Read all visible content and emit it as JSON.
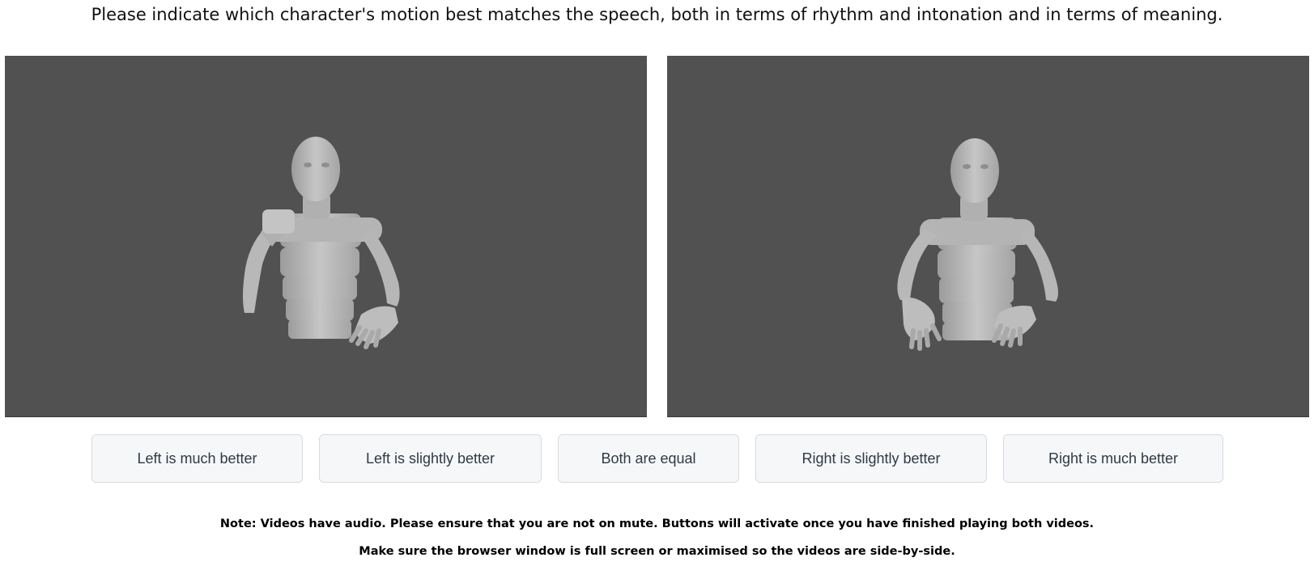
{
  "question": "Please indicate which character's motion best matches the speech, both in terms of rhythm and intonation and in terms of meaning.",
  "videos": {
    "left": {
      "description": "",
      "background": "#515151"
    },
    "right": {
      "description": "",
      "background": "#515151"
    }
  },
  "choices": [
    {
      "label": "Left is much better"
    },
    {
      "label": "Left is slightly better"
    },
    {
      "label": "Both are equal"
    },
    {
      "label": "Right is slightly better"
    },
    {
      "label": "Right is much better"
    }
  ],
  "notes": {
    "audio": "Note: Videos have audio. Please ensure that you are not on mute. Buttons will activate once you have finished playing both videos.",
    "fullscreen": "Make sure the browser window is full screen or maximised so the videos are side-by-side."
  },
  "colors": {
    "video_bg": "#515151",
    "button_bg": "#f6f7f9",
    "button_border": "#d7dbe0",
    "mannequin": "#c2c2c2"
  }
}
